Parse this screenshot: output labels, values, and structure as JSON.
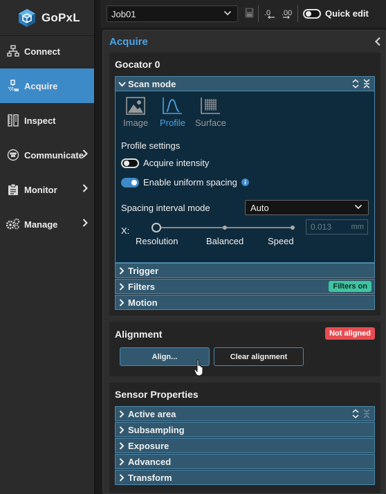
{
  "app": {
    "name": "GoPxL"
  },
  "nav": {
    "items": [
      {
        "label": "Connect",
        "icon": "network-icon",
        "active": false,
        "has_children": false
      },
      {
        "label": "Acquire",
        "icon": "acquire-icon",
        "active": true,
        "has_children": false
      },
      {
        "label": "Inspect",
        "icon": "inspect-icon",
        "active": false,
        "has_children": false
      },
      {
        "label": "Communicate",
        "icon": "communicate-icon",
        "active": false,
        "has_children": true
      },
      {
        "label": "Monitor",
        "icon": "monitor-icon",
        "active": false,
        "has_children": true
      },
      {
        "label": "Manage",
        "icon": "gears-icon",
        "active": false,
        "has_children": true
      }
    ]
  },
  "toolbar": {
    "job": "Job01",
    "quick_edit_label": "Quick edit",
    "quick_edit_on": false
  },
  "panel": {
    "title": "Acquire",
    "sensor": {
      "title": "Gocator 0",
      "scan_mode": {
        "header": "Scan mode",
        "modes": [
          {
            "label": "Image",
            "icon": "image-icon",
            "active": false
          },
          {
            "label": "Profile",
            "icon": "profile-icon",
            "active": true
          },
          {
            "label": "Surface",
            "icon": "surface-icon",
            "active": false
          }
        ],
        "profile_settings_label": "Profile settings",
        "acquire_intensity": {
          "label": "Acquire intensity",
          "on": false
        },
        "uniform_spacing": {
          "label": "Enable uniform spacing",
          "on": true
        },
        "spacing_mode_label": "Spacing interval mode",
        "spacing_mode_value": "Auto",
        "x_label": "X:",
        "slider_stops": [
          "Resolution",
          "Balanced",
          "Speed"
        ],
        "slider_selected": "Resolution",
        "x_value": "0.013",
        "x_unit": "mm"
      },
      "sections": [
        {
          "label": "Trigger"
        },
        {
          "label": "Filters",
          "badge": "Filters on"
        },
        {
          "label": "Motion"
        }
      ]
    },
    "alignment": {
      "title": "Alignment",
      "status": "Not aligned",
      "align_button": "Align...",
      "clear_button": "Clear alignment"
    },
    "sensor_properties": {
      "title": "Sensor Properties",
      "sections": [
        "Active area",
        "Subsampling",
        "Exposure",
        "Advanced",
        "Transform"
      ]
    }
  },
  "colors": {
    "accent": "#3d8ac8",
    "title_blue": "#4aa3e8",
    "section_bg": "#31586f",
    "body_bg": "#0e2b3d",
    "badge_green": "#3ec4a0",
    "badge_red": "#e84c52"
  }
}
